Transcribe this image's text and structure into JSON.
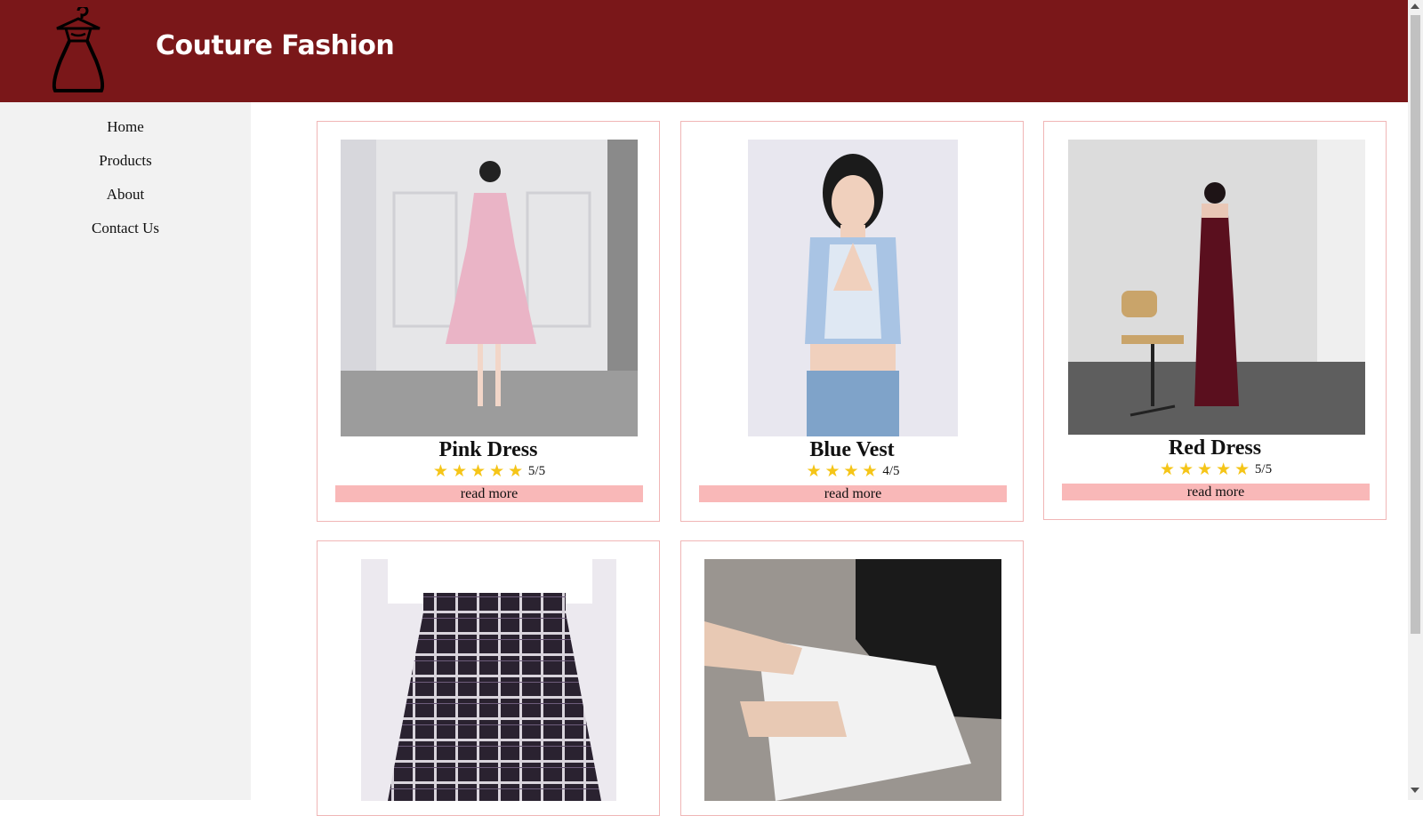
{
  "header": {
    "title": "Couture Fashion",
    "logo_icon": "dress-hanger-icon",
    "background": "#7a1719"
  },
  "sidebar": {
    "items": [
      {
        "label": "Home"
      },
      {
        "label": "Products"
      },
      {
        "label": "About"
      },
      {
        "label": "Contact Us"
      }
    ]
  },
  "products": [
    {
      "name": "Pink Dress",
      "rating_text": "5/5",
      "stars": 5,
      "read_more": "read more"
    },
    {
      "name": "Blue Vest",
      "rating_text": "4/5",
      "stars": 4,
      "read_more": "read more"
    },
    {
      "name": "Red Dress",
      "rating_text": "5/5",
      "stars": 5,
      "read_more": "read more"
    },
    {
      "name": "",
      "rating_text": "",
      "stars": 0,
      "read_more": ""
    },
    {
      "name": "",
      "rating_text": "",
      "stars": 0,
      "read_more": ""
    }
  ],
  "colors": {
    "accent": "#7a1719",
    "button": "#f9b8b8",
    "star": "#f5c518"
  }
}
